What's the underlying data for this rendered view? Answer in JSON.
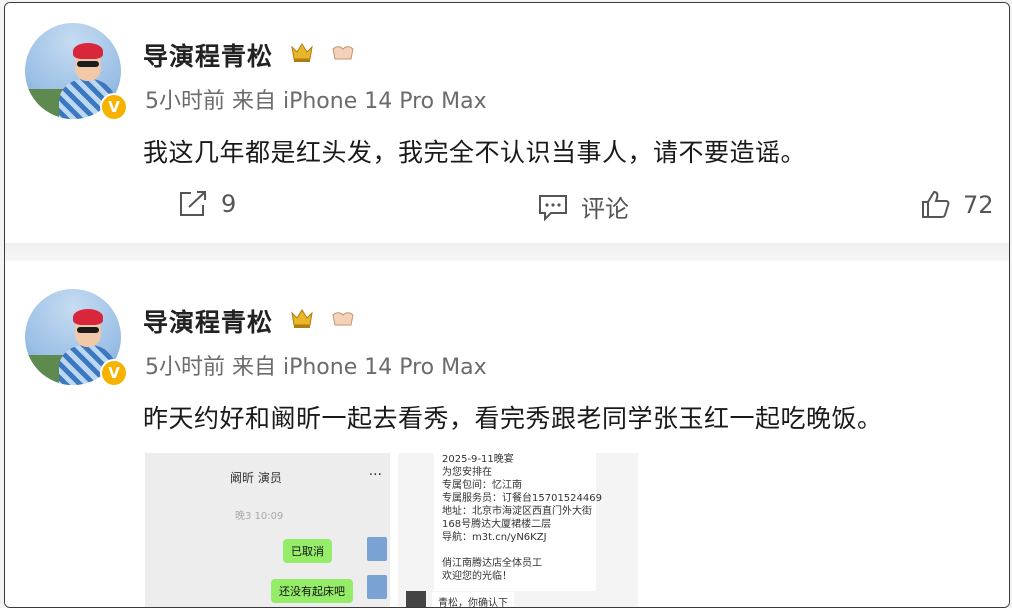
{
  "posts": [
    {
      "author": "导演程青松",
      "meta": "5小时前  来自 iPhone 14 Pro Max",
      "content": "我这几年都是红头发，我完全不认识当事人，请不要造谣。",
      "repost_count": "9",
      "comment_label": "评论",
      "like_count": "72"
    },
    {
      "author": "导演程青松",
      "meta": "5小时前  来自 iPhone 14 Pro Max",
      "content": "昨天约好和阚昕一起去看秀，看完秀跟老同学张玉红一起吃晚饭。",
      "image1": {
        "title": "阚昕 演员",
        "dots": "···",
        "time": "晚3 10:09",
        "bubble1": "已取消",
        "bubble2": "还没有起床吧"
      },
      "image2": {
        "lines": [
          "2025-9-11晚宴",
          "为您安排在",
          "专属包间：忆江南",
          "专属服务员：订餐台15701524469",
          "地址：北京市海淀区西直门外大街",
          "168号腾达大厦裙楼二层",
          "导航：m3t.cn/yN6KZJ",
          "",
          "俏江南腾达店全体员工",
          "欢迎您的光临！"
        ],
        "footer": "青松，你确认下"
      }
    }
  ],
  "colors": {
    "verified_badge": "#f5b300",
    "meta_text": "#6b6b6b",
    "chat_bubble": "#95ec69"
  },
  "icons": [
    "avatar",
    "verified-badge-icon",
    "crown-icon",
    "handshake-icon",
    "repost-icon",
    "comment-icon",
    "like-icon"
  ]
}
